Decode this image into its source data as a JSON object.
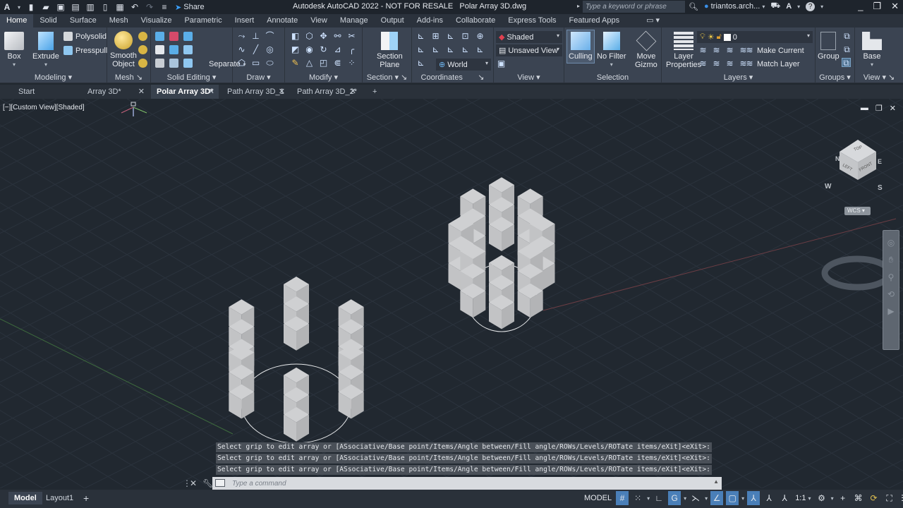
{
  "titlebar": {
    "app_title": "Autodesk AutoCAD 2022 - NOT FOR RESALE",
    "file_name": "Polar Array 3D.dwg",
    "share_label": "Share",
    "search_placeholder": "Type a keyword or phrase",
    "user_name": "triantos.arch...",
    "quick_access_icons": [
      "new-icon",
      "open-icon",
      "save-icon",
      "save-as-icon",
      "plot-preview-icon",
      "export-icon",
      "print-icon",
      "undo-icon",
      "redo-icon",
      "customize-icon"
    ]
  },
  "ribbon_tabs": [
    "Home",
    "Solid",
    "Surface",
    "Mesh",
    "Visualize",
    "Parametric",
    "Insert",
    "Annotate",
    "View",
    "Manage",
    "Output",
    "Add-ins",
    "Collaborate",
    "Express Tools",
    "Featured Apps"
  ],
  "active_ribbon_tab": "Home",
  "ribbon": {
    "modeling": {
      "label": "Modeling",
      "box": "Box",
      "extrude": "Extrude",
      "polysolid": "Polysolid",
      "presspull": "Presspull"
    },
    "mesh": {
      "label": "Mesh",
      "smooth_object_1": "Smooth",
      "smooth_object_2": "Object"
    },
    "solid_editing": {
      "label": "Solid Editing",
      "separate": "Separate"
    },
    "draw": {
      "label": "Draw"
    },
    "modify": {
      "label": "Modify"
    },
    "section": {
      "label": "Section",
      "section_plane_1": "Section",
      "section_plane_2": "Plane"
    },
    "coordinates": {
      "label": "Coordinates",
      "ucs": "World"
    },
    "view": {
      "label": "View",
      "visual_style": "Shaded",
      "named_view": "Unsaved View"
    },
    "selection": {
      "label": "Selection",
      "culling": "Culling",
      "no_filter": "No Filter",
      "move_gizmo_1": "Move",
      "move_gizmo_2": "Gizmo"
    },
    "layers": {
      "label": "Layers",
      "layer_properties_1": "Layer",
      "layer_properties_2": "Properties",
      "current_layer": "0",
      "make_current": "Make Current",
      "match_layer": "Match Layer"
    },
    "groups": {
      "label": "Groups",
      "group": "Group"
    },
    "view2": {
      "label": "View",
      "base": "Base"
    }
  },
  "doc_tabs": [
    {
      "label": "Start",
      "active": false,
      "closable": false
    },
    {
      "label": "Array 3D*",
      "active": false,
      "closable": true
    },
    {
      "label": "Polar Array 3D*",
      "active": true,
      "closable": true
    },
    {
      "label": "Path Array 3D_1",
      "active": false,
      "closable": true
    },
    {
      "label": "Path Array 3D_2*",
      "active": false,
      "closable": true
    }
  ],
  "viewport": {
    "label": "[−][Custom View][Shaded]",
    "viewcube": {
      "top": "TOP",
      "left": "LEFT",
      "front": "FRONT",
      "compass": [
        "N",
        "E",
        "S",
        "W"
      ],
      "ucs_badge": "WCS"
    }
  },
  "command_history": [
    "Select grip to edit array or [ASsociative/Base point/Items/Angle between/Fill angle/ROWs/Levels/ROTate items/eXit]<eXit>:",
    "Select grip to edit array or [ASsociative/Base point/Items/Angle between/Fill angle/ROWs/Levels/ROTate items/eXit]<eXit>:",
    "Select grip to edit array or [ASsociative/Base point/Items/Angle between/Fill angle/ROWs/Levels/ROTate items/eXit]<eXit>:"
  ],
  "command_line": {
    "placeholder": "Type a command"
  },
  "layout_tabs": [
    {
      "label": "Model",
      "active": true
    },
    {
      "label": "Layout1",
      "active": false
    }
  ],
  "statusbar": {
    "model": "MODEL",
    "annotation_scale": "1:1"
  },
  "colors": {
    "accent": "#4a7fb8",
    "background": "#212830",
    "ribbon": "#3b4452",
    "autocad_red": "#e0262f"
  }
}
